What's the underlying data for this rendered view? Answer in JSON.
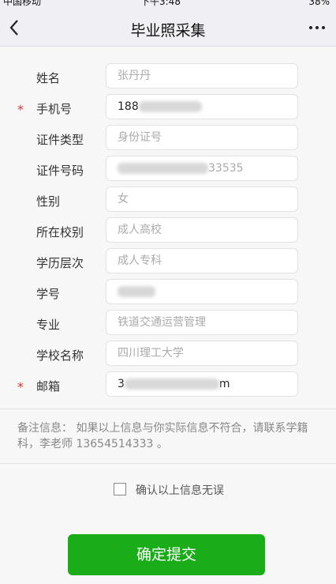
{
  "status_bar": {
    "carrier": "中国移动",
    "time": "下午3:48",
    "battery": "38%"
  },
  "nav": {
    "title": "毕业照采集"
  },
  "form": {
    "rows": [
      {
        "label": "姓名",
        "required": false,
        "value": "张丹丹",
        "placeholder": true
      },
      {
        "label": "手机号",
        "required": true,
        "value": "188",
        "placeholder": false,
        "blurred_tail": true
      },
      {
        "label": "证件类型",
        "required": false,
        "value": "身份证号",
        "placeholder": true
      },
      {
        "label": "证件号码",
        "required": false,
        "value": "33535",
        "placeholder": true,
        "blurred_head": true
      },
      {
        "label": "性别",
        "required": false,
        "value": "女",
        "placeholder": true
      },
      {
        "label": "所在校别",
        "required": false,
        "value": "成人高校",
        "placeholder": true
      },
      {
        "label": "学历层次",
        "required": false,
        "value": "成人专科",
        "placeholder": true
      },
      {
        "label": "学号",
        "required": false,
        "value": "",
        "placeholder": true,
        "blurred_all": true
      },
      {
        "label": "专业",
        "required": false,
        "value": "铁道交通运营管理",
        "placeholder": true
      },
      {
        "label": "学校名称",
        "required": false,
        "value": "四川理工大学",
        "placeholder": true
      },
      {
        "label": "邮箱",
        "required": true,
        "value_prefix": "3",
        "value_suffix": "m",
        "placeholder": false,
        "blurred_middle": true
      }
    ],
    "required_mark": "*"
  },
  "remark": {
    "text": "备注信息：  如果以上信息与你实际信息不符合，请联系学籍科，李老师 13654514333 。"
  },
  "confirm": {
    "label": "确认以上信息无误",
    "checked": false
  },
  "submit": {
    "label": "确定提交"
  },
  "colors": {
    "primary": "#1aad19",
    "required": "#d9362f"
  }
}
